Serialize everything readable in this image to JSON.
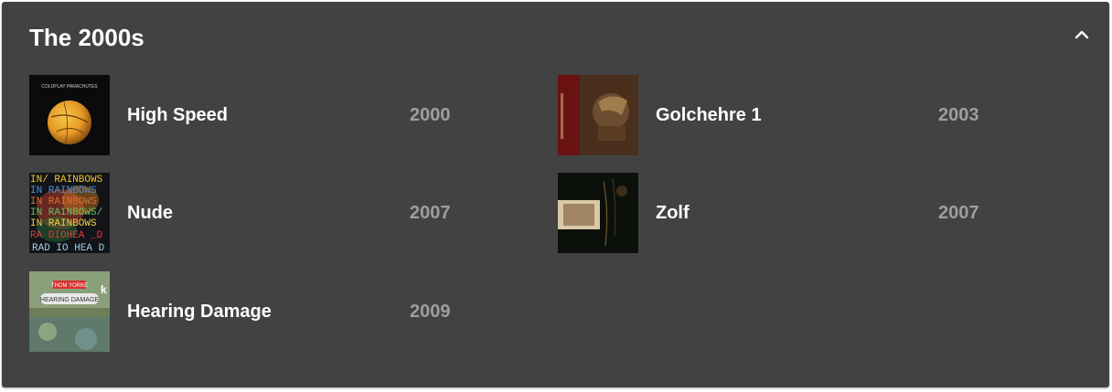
{
  "section": {
    "title": "The 2000s",
    "collapse_icon": "chevron-up-icon"
  },
  "songs": [
    {
      "title": "High Speed",
      "year": "2000",
      "art_text": "COLDPLAY PARACHUTES"
    },
    {
      "title": "Golchehre 1",
      "year": "2003"
    },
    {
      "title": "Nude",
      "year": "2007",
      "art_lines": [
        "IN/ RAINBOWS",
        "IN RAINBOWS",
        "IN RAINBOWS",
        "IN RAINBOWS/",
        "IN RAINBOWS",
        "RA DIOHEA _D",
        "RAD IO HEA D"
      ]
    },
    {
      "title": "Zolf",
      "year": "2007"
    },
    {
      "title": "Hearing Damage",
      "year": "2009",
      "art_lines": [
        "THOM YORKE",
        "HEARING DAMAGE"
      ]
    }
  ],
  "colors": {
    "card_bg": "#424242",
    "title": "#ffffff",
    "year": "#9e9e9e"
  }
}
